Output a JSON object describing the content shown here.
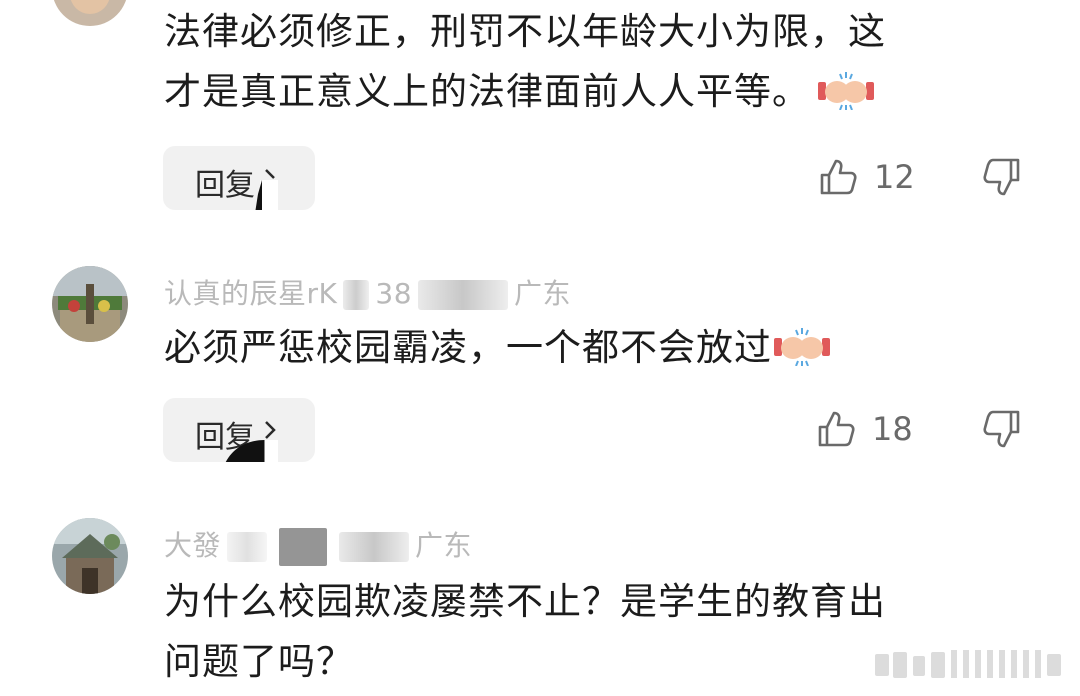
{
  "comments": [
    {
      "author": "",
      "meta": "",
      "text_line1": "法律必须修正，刑罚不以年龄大小为限，这",
      "text_line2": "才是真正意义上的法律面前人人平等。",
      "emoji": "fist-bump-emoji",
      "reply_label": "回复",
      "likes": "12"
    },
    {
      "author": "认真的辰星rK",
      "meta_visible": "38",
      "location": "广东",
      "text_line1": "必须严惩校园霸凌，一个都不会放过",
      "emoji": "fist-bump-emoji",
      "reply_label": "回复",
      "likes": "18"
    },
    {
      "author": "大發",
      "location": "广东",
      "text_line1": "为什么校园欺凌屡禁不止？是学生的教育出",
      "text_line2": "问题了吗？"
    }
  ],
  "colors": {
    "text": "#1c1c1c",
    "meta": "#b9b9b9",
    "reply_bg": "#f1f1f1",
    "icon": "#6a6a6a"
  },
  "icons": [
    "thumbs-up-icon",
    "thumbs-down-icon",
    "chevron-right-icon",
    "fist-bump-emoji"
  ]
}
